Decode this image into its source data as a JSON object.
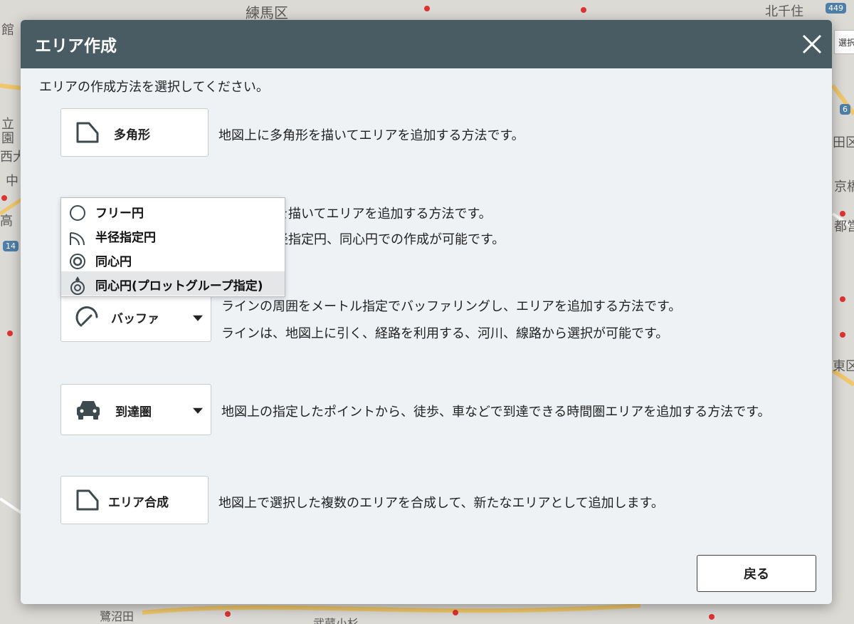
{
  "map": {
    "labels": [
      "練馬区",
      "北千住",
      "館",
      "立",
      "園",
      "西大",
      "中",
      "高",
      "田区",
      "京橋",
      "都営",
      "東区",
      "鷺沼田",
      "武蔵小杉"
    ],
    "badges": [
      "449",
      "6",
      "14"
    ],
    "top_button": "選択ヤ"
  },
  "modal": {
    "title": "エリア作成",
    "instruction": "エリアの作成方法を選択してください。",
    "options": {
      "polygon": {
        "label": "多角形",
        "desc": "地図上に多角形を描いてエリアを追加する方法です。"
      },
      "circle": {
        "desc_line1": "円を描いてエリアを追加する方法です。",
        "desc_line2": "半径指定円、同心円での作成が可能です。"
      },
      "buffer": {
        "label": "バッファ",
        "desc_line1": "ラインの周囲をメートル指定でバッファリングし、エリアを追加する方法です。",
        "desc_line2": "ラインは、地図上に引く、経路を利用する、河川、線路から選択が可能です。"
      },
      "reach": {
        "label": "到達圏",
        "desc": "地図上の指定したポイントから、徒歩、車などで到達できる時間圏エリアを追加する方法です。"
      },
      "merge": {
        "label": "エリア合成",
        "desc": "地図上で選択した複数のエリアを合成して、新たなエリアとして追加します。"
      }
    },
    "dropdown": {
      "items": [
        {
          "label": "フリー円",
          "icon": "circle-outline-icon"
        },
        {
          "label": "半径指定円",
          "icon": "radius-arc-icon"
        },
        {
          "label": "同心円",
          "icon": "concentric-circle-icon"
        },
        {
          "label": "同心円(プロットグループ指定)",
          "icon": "concentric-pin-icon"
        }
      ],
      "active_index": 3
    },
    "back_label": "戻る"
  },
  "colors": {
    "header": "#4a5c63",
    "modal_bg": "#eef2f5"
  }
}
